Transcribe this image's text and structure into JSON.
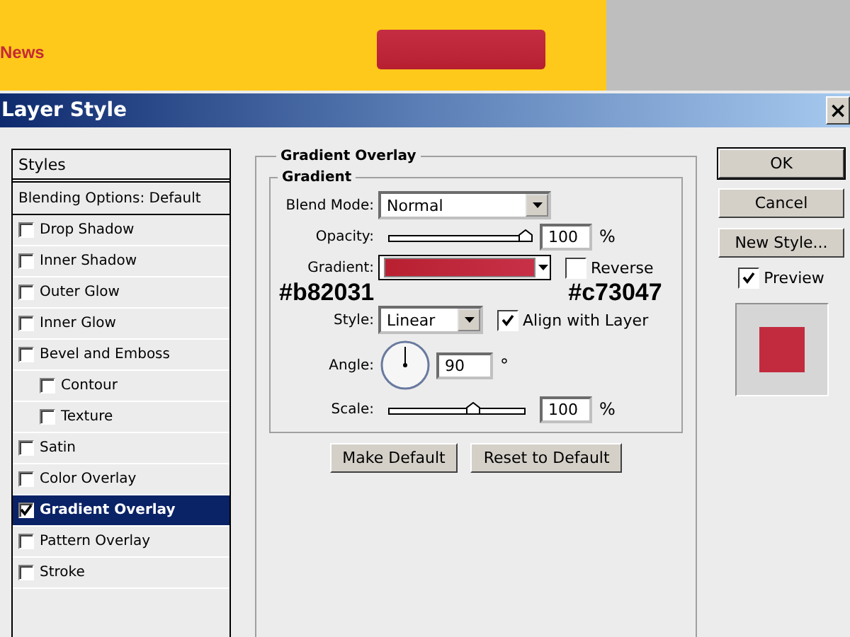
{
  "banner": {
    "link": "News"
  },
  "window": {
    "title": "Layer Style",
    "close": "×"
  },
  "styles_list": {
    "header": "Styles",
    "blending": "Blending Options: Default",
    "items": [
      {
        "label": "Drop Shadow",
        "checked": false,
        "selected": false
      },
      {
        "label": "Inner Shadow",
        "checked": false,
        "selected": false
      },
      {
        "label": "Outer Glow",
        "checked": false,
        "selected": false
      },
      {
        "label": "Inner Glow",
        "checked": false,
        "selected": false
      },
      {
        "label": "Bevel and Emboss",
        "checked": false,
        "selected": false,
        "children": [
          {
            "label": "Contour",
            "checked": false,
            "selected": false
          },
          {
            "label": "Texture",
            "checked": false,
            "selected": false
          }
        ]
      },
      {
        "label": "Satin",
        "checked": false,
        "selected": false
      },
      {
        "label": "Color Overlay",
        "checked": false,
        "selected": false
      },
      {
        "label": "Gradient Overlay",
        "checked": true,
        "selected": true
      },
      {
        "label": "Pattern Overlay",
        "checked": false,
        "selected": false
      },
      {
        "label": "Stroke",
        "checked": false,
        "selected": false
      }
    ]
  },
  "panel": {
    "title": "Gradient Overlay",
    "group": "Gradient",
    "blend_mode": {
      "label": "Blend Mode:",
      "value": "Normal"
    },
    "opacity": {
      "label": "Opacity:",
      "level": 1.0,
      "value": "100",
      "unit": "%"
    },
    "gradient": {
      "label": "Gradient:",
      "stops": [
        "#b82031",
        "#c73047"
      ]
    },
    "reverse": {
      "label": "Reverse",
      "checked": false
    },
    "style": {
      "label": "Style:",
      "value": "Linear"
    },
    "align": {
      "label": "Align with Layer",
      "checked": true
    },
    "angle": {
      "label": "Angle:",
      "value": "90",
      "unit": "°"
    },
    "scale": {
      "label": "Scale:",
      "level": 0.62,
      "value": "100",
      "unit": "%"
    },
    "buttons": [
      "Make Default",
      "Reset to Default"
    ]
  },
  "actions": {
    "buttons": [
      {
        "label": "OK",
        "default": true
      },
      {
        "label": "Cancel",
        "default": false
      },
      {
        "label": "New Style...",
        "default": false
      }
    ],
    "preview": {
      "label": "Preview",
      "checked": true
    }
  }
}
